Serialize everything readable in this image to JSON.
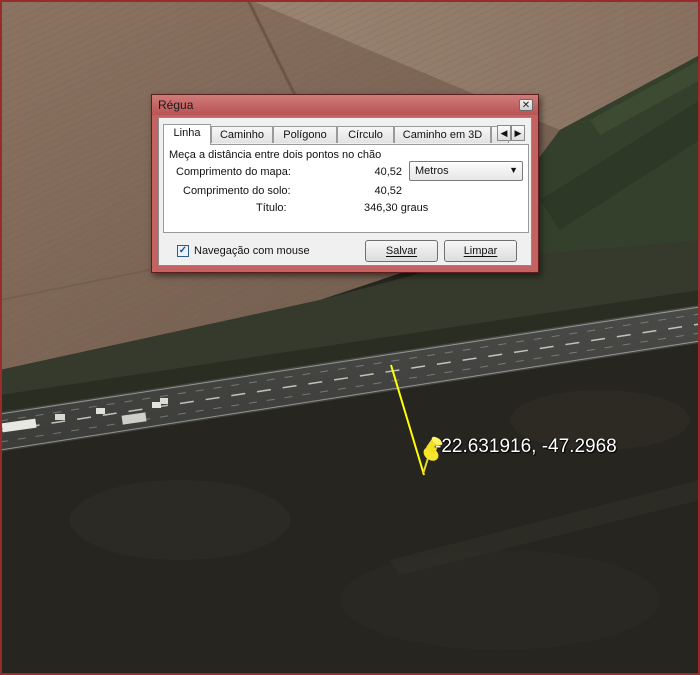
{
  "dialog": {
    "title": "Régua",
    "close_icon": "close-icon",
    "tabs": [
      {
        "label": "Linha"
      },
      {
        "label": "Caminho"
      },
      {
        "label": "Polígono"
      },
      {
        "label": "Círculo"
      },
      {
        "label": "Caminho em 3D"
      }
    ],
    "active_tab": "Linha",
    "description": "Meça a distância entre dois pontos no chão",
    "map_length_label": "Comprimento do mapa:",
    "map_length_value": "40,52",
    "units_selected": "Metros",
    "ground_length_label": "Comprimento do solo:",
    "ground_length_value": "40,52",
    "heading_label": "Título:",
    "heading_value": "346,30 graus",
    "mouse_nav_label": "Navegação com mouse",
    "mouse_nav_checked": true,
    "save_label": "Salvar",
    "clear_label": "Limpar"
  },
  "map": {
    "pin_icon": "pushpin-icon",
    "pin_color": "#f5e62a",
    "measure_line_color": "#ffff00",
    "placemark_label": "-22.631916, -47.2968"
  }
}
